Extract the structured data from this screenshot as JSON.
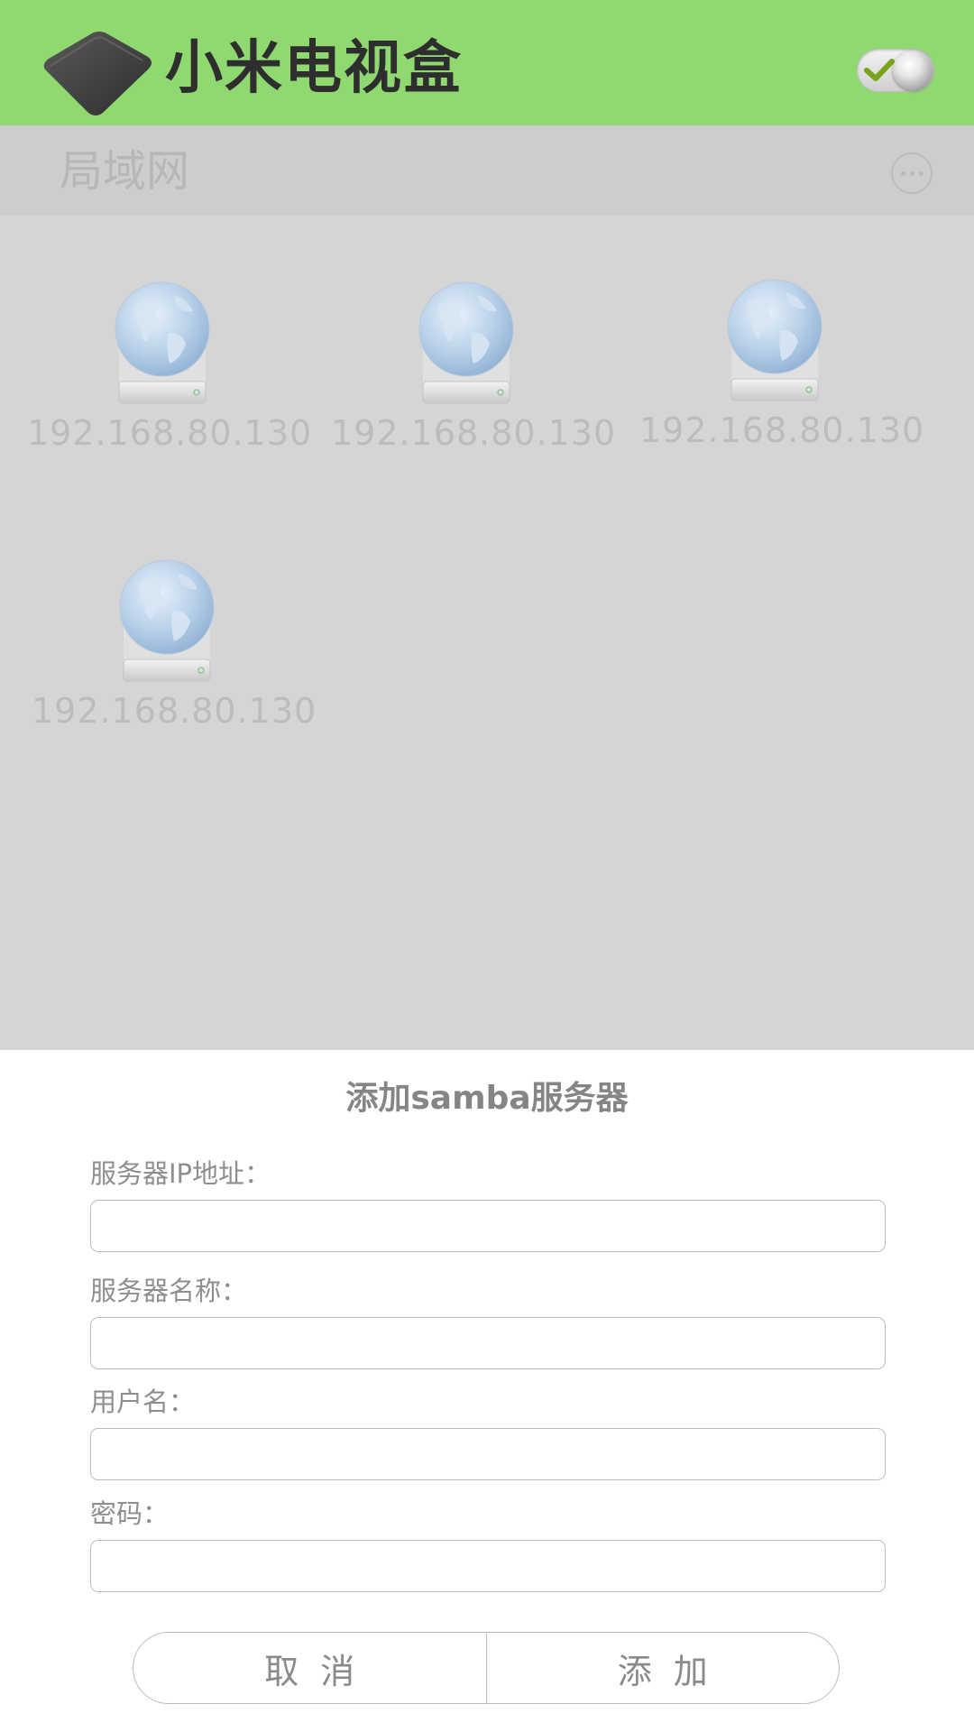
{
  "header": {
    "title": "小米电视盒",
    "logo_icon": "tv-box-icon",
    "toggle": {
      "icon": "toggle-switch-icon",
      "state": "on"
    },
    "background": "#8fd970"
  },
  "network": {
    "section_title": "局域网",
    "more_icon": "more-options-icon",
    "servers": [
      {
        "ip": "192.168.80.130",
        "icon": "network-globe-drive-icon"
      },
      {
        "ip": "192.168.80.130",
        "icon": "network-globe-drive-icon"
      },
      {
        "ip": "192.168.80.130",
        "icon": "network-globe-drive-icon"
      },
      {
        "ip": "192.168.80.130",
        "icon": "network-globe-drive-icon"
      }
    ]
  },
  "dialog": {
    "title": "添加samba服务器",
    "fields": [
      {
        "label": "服务器IP地址：",
        "value": "",
        "placeholder": ""
      },
      {
        "label": "服务器名称：",
        "value": "",
        "placeholder": ""
      },
      {
        "label": "用户名：",
        "value": "",
        "placeholder": ""
      },
      {
        "label": "密码：",
        "value": "",
        "placeholder": ""
      }
    ],
    "cancel_label": "取消",
    "add_label": "添加"
  }
}
